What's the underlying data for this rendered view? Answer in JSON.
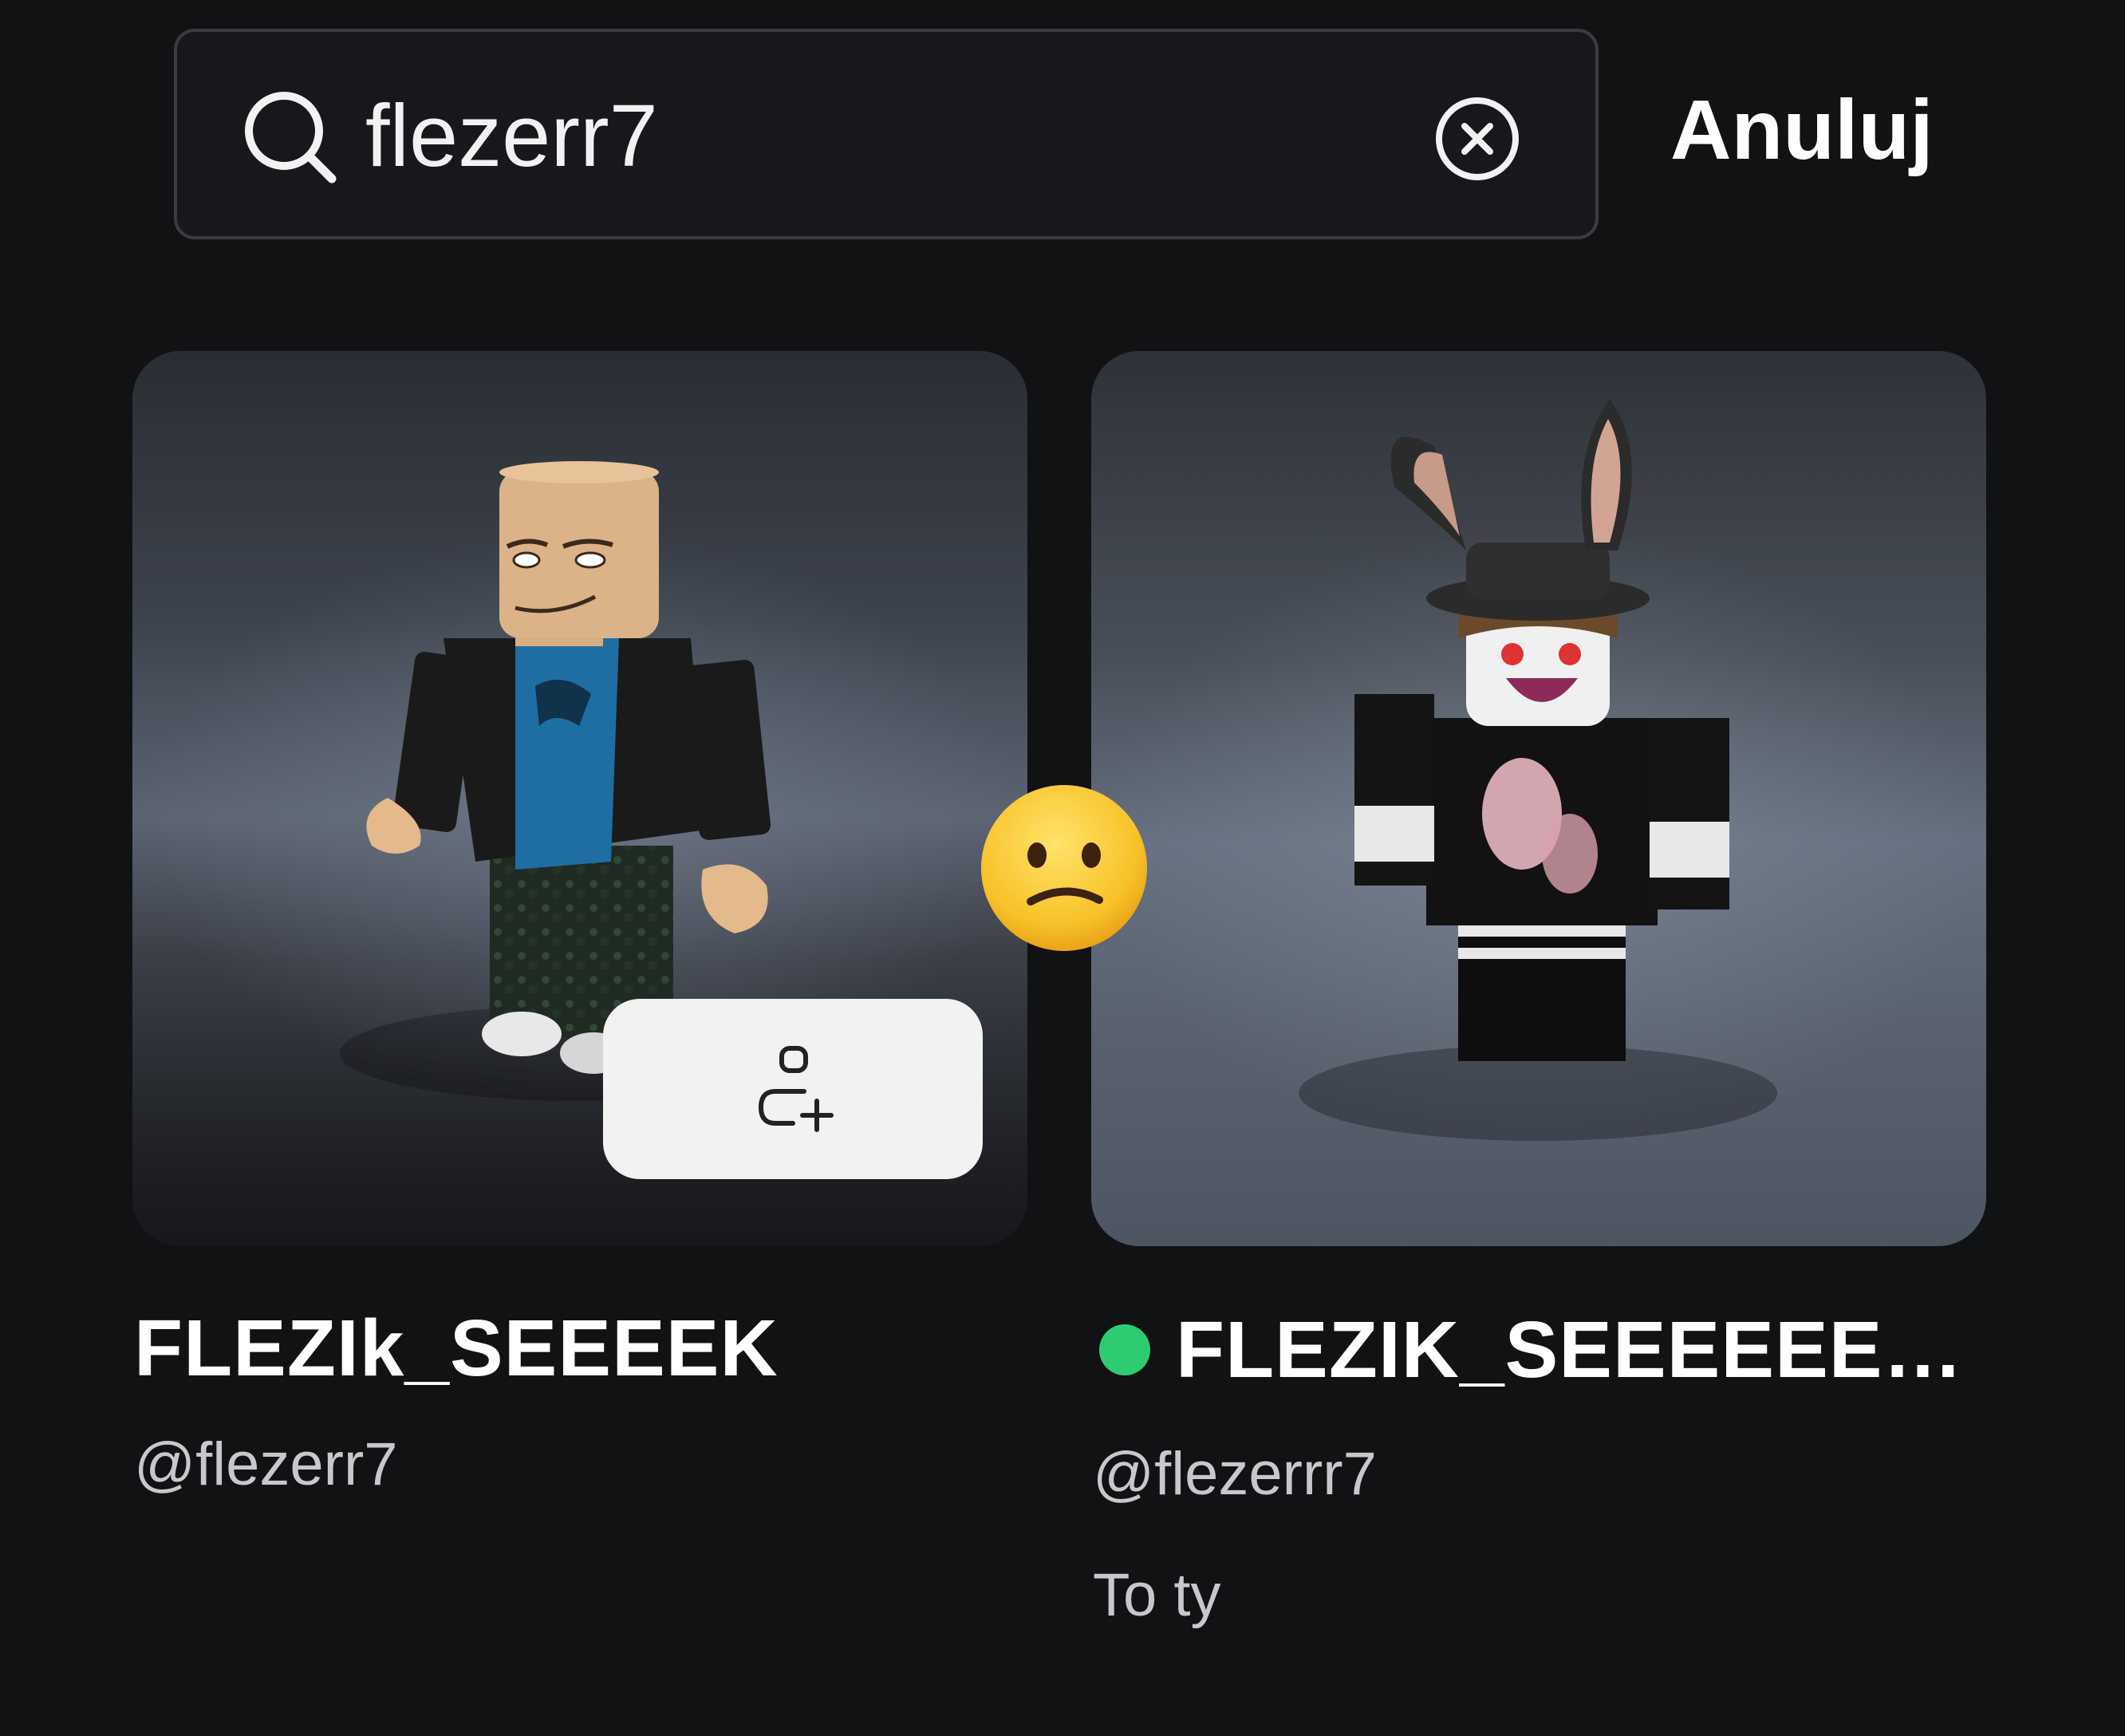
{
  "search": {
    "value": "flezerr7",
    "cancel_label": "Anuluj"
  },
  "results": [
    {
      "display_name": "FLEZIk_SEEEEK",
      "username": "@flezerr7",
      "online": false,
      "action_icon": "add-friend-icon"
    },
    {
      "display_name": "FLEZIK_SEEEEEEE...",
      "username": "@flezerrr7",
      "online": true,
      "status_color": "#2ecc71",
      "note": "To ty"
    }
  ],
  "overlay": {
    "emoji": "confused-face"
  },
  "colors": {
    "background": "#111214",
    "online": "#2ecc71"
  }
}
